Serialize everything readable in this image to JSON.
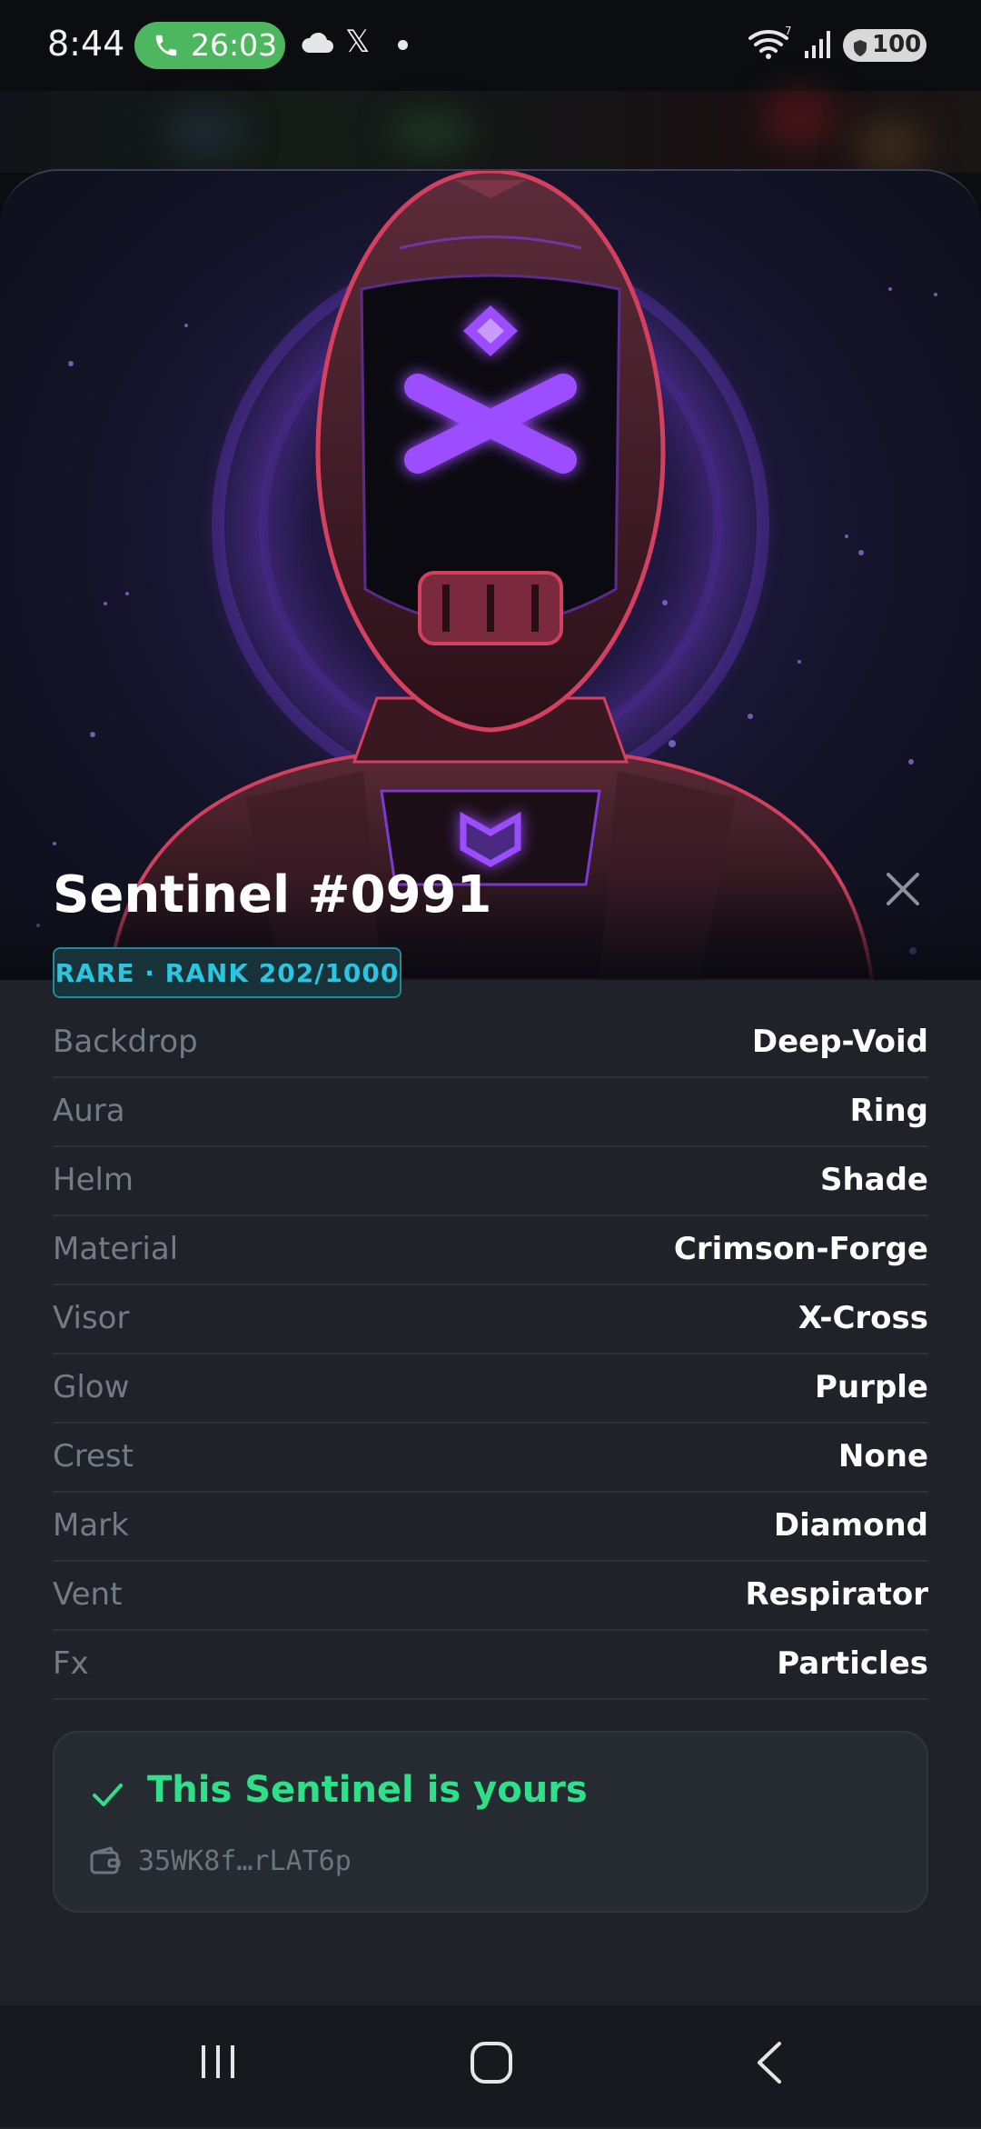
{
  "status_bar": {
    "time": "8:44",
    "call_duration": "26:03",
    "x_glyph": "𝕏",
    "battery_level": "100",
    "icons": [
      "phone-icon",
      "cloud-icon",
      "x-app-icon",
      "notification-dot",
      "wifi-icon",
      "signal-icon",
      "battery-shield-icon"
    ]
  },
  "nft": {
    "title": "Sentinel #0991",
    "rank_badge": "RARE · RANK 202/1000",
    "traits": [
      {
        "key": "Backdrop",
        "value": "Deep-Void"
      },
      {
        "key": "Aura",
        "value": "Ring"
      },
      {
        "key": "Helm",
        "value": "Shade"
      },
      {
        "key": "Material",
        "value": "Crimson-Forge"
      },
      {
        "key": "Visor",
        "value": "X-Cross"
      },
      {
        "key": "Glow",
        "value": "Purple"
      },
      {
        "key": "Crest",
        "value": "None"
      },
      {
        "key": "Mark",
        "value": "Diamond"
      },
      {
        "key": "Vent",
        "value": "Respirator"
      },
      {
        "key": "Fx",
        "value": "Particles"
      }
    ]
  },
  "ownership": {
    "message": "This Sentinel is yours",
    "wallet_address": "35WK8f…rLAT6p"
  },
  "colors": {
    "accent_green": "#2ee08a",
    "badge_cyan": "#28c6e0",
    "glow_purple": "#9b4dff",
    "crimson": "#d4405f",
    "call_green": "#4cb75e"
  },
  "nav": {
    "buttons": [
      "recent-apps-button",
      "home-button",
      "back-button"
    ]
  }
}
